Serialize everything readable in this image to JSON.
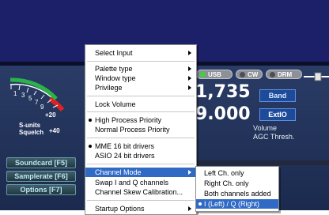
{
  "smeter": {
    "scale_labels": [
      "1",
      "3",
      "5",
      "7",
      "9"
    ],
    "s_units": "S-units",
    "squelch": "Squelch",
    "plus20": "+20",
    "plus40": "+40"
  },
  "side_buttons": {
    "soundcard": "Soundcard [F5]",
    "samplerate": "Samplerate [F6]",
    "options": "Options [F7]"
  },
  "modes": {
    "usb": "USB",
    "cw": "CW",
    "drm": "DRM"
  },
  "frequency": {
    "line1": "1,735",
    "line2": "9.000"
  },
  "buttons": {
    "band": "Band",
    "extio": "ExtIO"
  },
  "labels": {
    "volume": "Volume",
    "agc": "AGC Thresh."
  },
  "menu": {
    "select_input": "Select Input",
    "palette_type": "Palette type",
    "window_type": "Window type",
    "privilege": "Privilege",
    "lock_volume": "Lock Volume",
    "high_priority": "High Process Priority",
    "normal_priority": "Normal Process Priority",
    "mme": "MME 16 bit drivers",
    "asio": "ASIO  24 bit drivers",
    "channel_mode": "Channel Mode",
    "swap_iq": "Swap I and Q channels",
    "skew": "Channel Skew Calibration...",
    "startup": "Startup Options"
  },
  "submenu": {
    "left_only": "Left Ch. only",
    "right_only": "Right Ch. only",
    "both": "Both channels added",
    "iq": "I (Left) / Q (Right)"
  },
  "colors": {
    "highlight": "#316ac5",
    "panel": "#1c2548",
    "led_on": "#3bd43b"
  }
}
